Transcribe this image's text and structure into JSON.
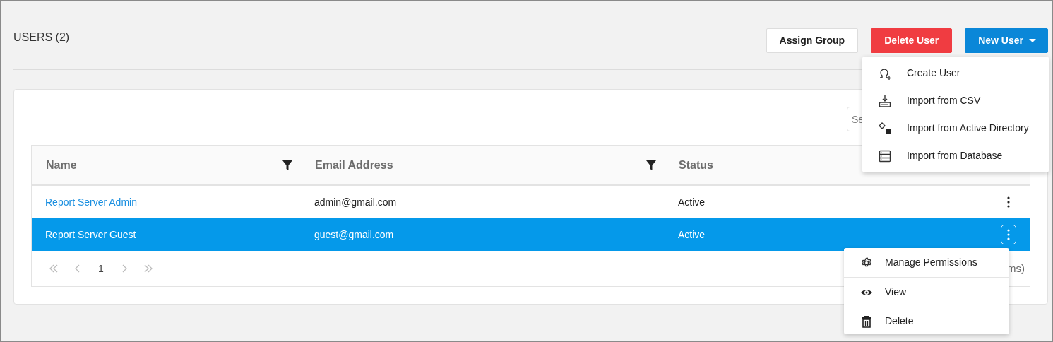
{
  "page": {
    "title": "USERS (2)"
  },
  "buttons": [
    {
      "label": "Assign Group",
      "kind": "outline"
    },
    {
      "label": "Delete User",
      "kind": "danger"
    },
    {
      "label": "New User",
      "kind": "dropdown"
    }
  ],
  "new_user_menu": {
    "expanded": true,
    "items": [
      {
        "label": "Create User",
        "kind": "create"
      },
      {
        "label": "Import from CSV",
        "kind": "csv"
      },
      {
        "label": "Import from Active Directory",
        "kind": "directory"
      },
      {
        "label": "Import from Database",
        "kind": "database"
      }
    ]
  },
  "search": {
    "placeholder": "Se"
  },
  "table": {
    "columns": [
      {
        "label": "Name",
        "filter": true
      },
      {
        "label": "Email Address",
        "filter": true
      },
      {
        "label": "Status"
      }
    ],
    "rows": [
      {
        "cells": [
          "Report Server Admin",
          "admin@gmail.com",
          "Active"
        ],
        "selected": false
      },
      {
        "cells": [
          "Report Server Guest",
          "guest@gmail.com",
          "Active"
        ],
        "selected": true
      }
    ]
  },
  "pager": {
    "page": "1",
    "info": "ms)"
  },
  "row_menu": {
    "expanded": true,
    "items": [
      {
        "label": "Manage Permissions",
        "kind": "settings",
        "divider_after": true
      },
      {
        "label": "View",
        "kind": "view",
        "divider_after": false
      },
      {
        "label": "Delete",
        "kind": "delete",
        "divider_after": false
      }
    ]
  }
}
